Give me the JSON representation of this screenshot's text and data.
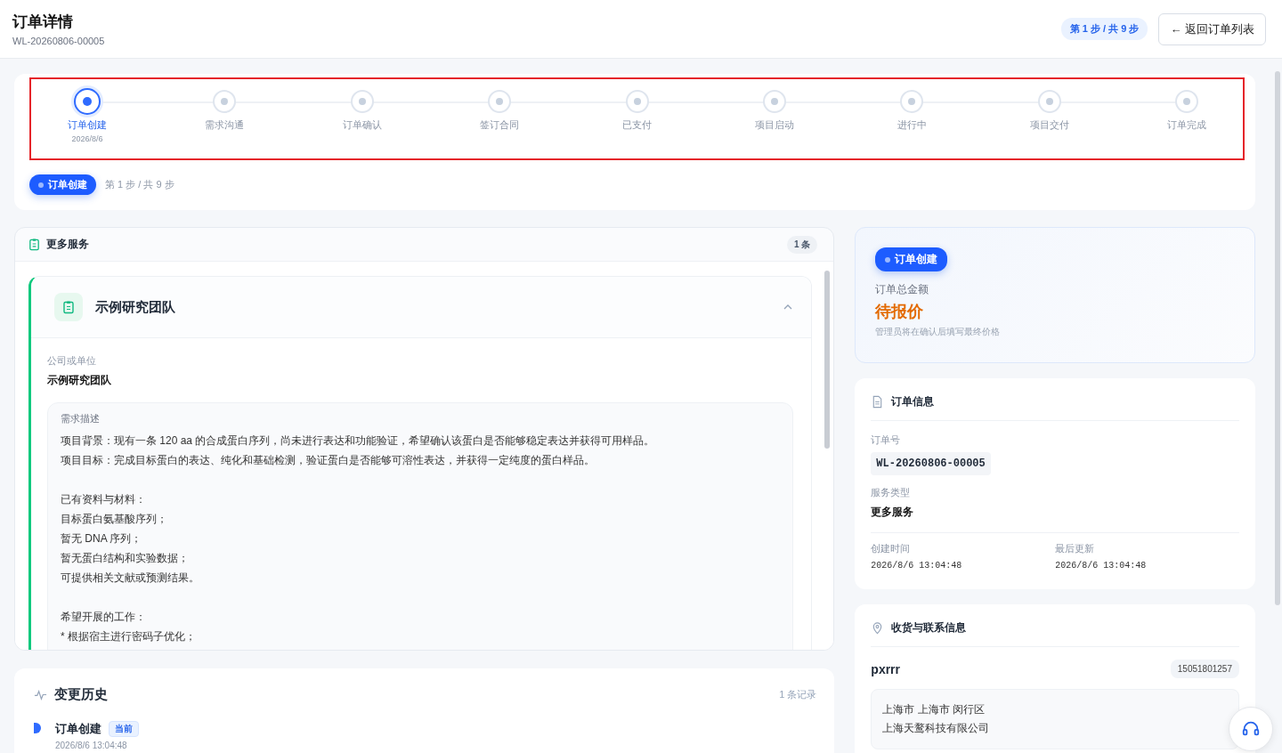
{
  "header": {
    "title": "订单详情",
    "order_no": "WL-20260806-00005",
    "step_badge": "第 1 步 / 共 9 步",
    "back_button": "← 返回订单列表"
  },
  "stepper": {
    "steps": [
      {
        "label": "订单创建",
        "date": "2026/8/6",
        "selected": true
      },
      {
        "label": "需求沟通",
        "selected": false
      },
      {
        "label": "订单确认",
        "selected": false
      },
      {
        "label": "签订合同",
        "selected": false
      },
      {
        "label": "已支付",
        "selected": false
      },
      {
        "label": "项目启动",
        "selected": false
      },
      {
        "label": "进行中",
        "selected": false
      },
      {
        "label": "项目交付",
        "selected": false
      },
      {
        "label": "订单完成",
        "selected": false
      }
    ],
    "current_pill": "订单创建",
    "step_text": "第 1 步 / 共 9 步"
  },
  "services": {
    "title": "更多服务",
    "count": "1 条",
    "items": [
      {
        "name": "示例研究团队",
        "expanded": true,
        "company_label": "公司或单位",
        "company": "示例研究团队",
        "desc_label": "需求描述",
        "paragraphs": [
          [
            "项目背景：现有一条 120 aa 的合成蛋白序列，尚未进行表达和功能验证，希望确认该蛋白是否能够稳定表达并获得可用样品。",
            "项目目标：完成目标蛋白的表达、纯化和基础检测，验证蛋白是否能够可溶性表达，并获得一定纯度的蛋白样品。"
          ],
          [
            "已有资料与材料：",
            "目标蛋白氨基酸序列；",
            "暂无 DNA 序列；",
            "暂无蛋白结构和实验数据；",
            "可提供相关文献或预测结果。"
          ],
          [
            "希望开展的工作：",
            "* 根据宿主进行密码子优化；"
          ]
        ]
      }
    ]
  },
  "history": {
    "title": "变更历史",
    "count": "1 条记录",
    "entries": [
      {
        "status": "订单创建",
        "tag": "当前",
        "time": "2026/8/6 13:04:48"
      }
    ]
  },
  "summary": {
    "status": "订单创建",
    "amount_label": "订单总金额",
    "amount": "待报价",
    "note": "管理员将在确认后填写最终价格"
  },
  "order_info": {
    "title": "订单信息",
    "no_label": "订单号",
    "no": "WL-20260806-00005",
    "type_label": "服务类型",
    "type": "更多服务",
    "created_label": "创建时间",
    "created": "2026/8/6 13:04:48",
    "updated_label": "最后更新",
    "updated": "2026/8/6 13:04:48"
  },
  "contact": {
    "title": "收货与联系信息",
    "name": "pxrrr",
    "phone": "15051801257",
    "address_lines": [
      "上海市 上海市 闵行区",
      "上海天鹜科技有限公司"
    ]
  }
}
